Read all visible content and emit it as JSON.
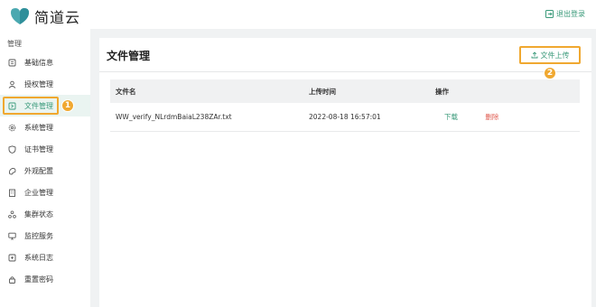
{
  "header": {
    "brand": "简道云",
    "logout_label": "退出登录"
  },
  "sidebar": {
    "group_label": "管理",
    "items": [
      {
        "label": "基础信息",
        "icon": "info-card-icon"
      },
      {
        "label": "授权管理",
        "icon": "user-icon"
      },
      {
        "label": "文件管理",
        "icon": "file-icon",
        "active": true
      },
      {
        "label": "系统管理",
        "icon": "gear-icon"
      },
      {
        "label": "证书管理",
        "icon": "shield-icon"
      },
      {
        "label": "外观配置",
        "icon": "appearance-icon"
      },
      {
        "label": "企业管理",
        "icon": "building-icon"
      },
      {
        "label": "集群状态",
        "icon": "cluster-icon"
      },
      {
        "label": "监控服务",
        "icon": "monitor-icon"
      },
      {
        "label": "系统日志",
        "icon": "log-icon"
      },
      {
        "label": "重置密码",
        "icon": "lock-icon"
      }
    ]
  },
  "annotations": {
    "badge_1": "1",
    "badge_2": "2"
  },
  "main": {
    "title": "文件管理",
    "upload_label": "文件上传",
    "table": {
      "columns": [
        "文件名",
        "上传时间",
        "操作"
      ],
      "rows": [
        {
          "filename": "WW_verify_NLrdmBaiaL238ZAr.txt",
          "time": "2022-08-18 16:57:01",
          "download": "下载",
          "delete": "删除"
        }
      ]
    }
  },
  "colors": {
    "accent": "#3a9a7a",
    "highlight": "#f0a830",
    "danger": "#e05a4f"
  }
}
